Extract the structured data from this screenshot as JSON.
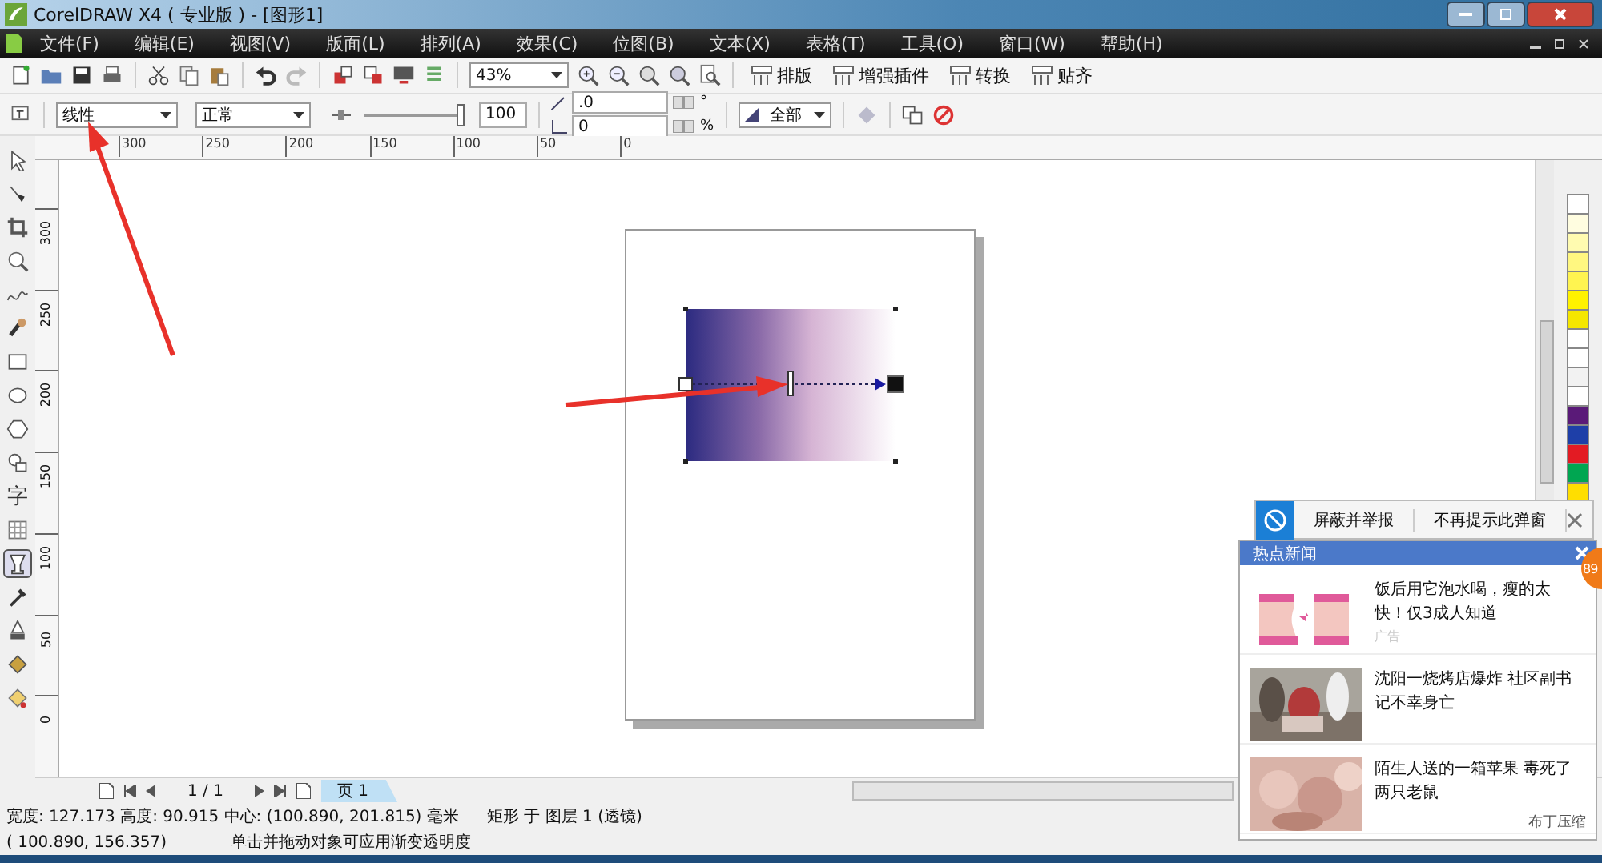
{
  "window": {
    "title": "CorelDRAW X4 ( 专业版 ) - [图形1]"
  },
  "menu": [
    "文件(F)",
    "编辑(E)",
    "视图(V)",
    "版面(L)",
    "排列(A)",
    "效果(C)",
    "位图(B)",
    "文本(X)",
    "表格(T)",
    "工具(O)",
    "窗口(W)",
    "帮助(H)"
  ],
  "toolbar": {
    "zoom": "43%",
    "buttons": [
      "排版",
      "增强插件",
      "转换",
      "贴齐"
    ]
  },
  "property_bar": {
    "fill_type": "线性",
    "mode": "正常",
    "slider": {
      "level": 1.0
    },
    "opacity": "100",
    "angle": ".0",
    "edge": "0",
    "angle_unit": "°",
    "edge_unit": "%",
    "target": "全部"
  },
  "ruler": {
    "horizontal": [
      "300",
      "250",
      "200",
      "150",
      "100",
      "50",
      "0"
    ],
    "vertical": [
      "300",
      "250",
      "200",
      "150",
      "100",
      "50",
      "0"
    ]
  },
  "tools": [
    {
      "kind": "pick",
      "selected": false
    },
    {
      "kind": "shape",
      "selected": false
    },
    {
      "kind": "crop",
      "selected": false
    },
    {
      "kind": "zoom",
      "selected": false
    },
    {
      "kind": "curve",
      "selected": false
    },
    {
      "kind": "smart",
      "selected": false
    },
    {
      "kind": "rect",
      "selected": false
    },
    {
      "kind": "ellipse",
      "selected": false
    },
    {
      "kind": "polygon",
      "selected": false
    },
    {
      "kind": "shapes",
      "selected": false
    },
    {
      "kind": "text",
      "label": "字",
      "selected": false
    },
    {
      "kind": "table",
      "selected": false
    },
    {
      "kind": "transparency",
      "selected": true
    },
    {
      "kind": "eyedropper",
      "selected": false
    },
    {
      "kind": "outline",
      "selected": false
    },
    {
      "kind": "fill",
      "selected": false
    },
    {
      "kind": "smartfill",
      "selected": false
    }
  ],
  "palette": [
    {
      "color": "#ffffff"
    },
    {
      "color": "#fffde0"
    },
    {
      "color": "#fffbb0"
    },
    {
      "color": "#fff780"
    },
    {
      "color": "#fff450"
    },
    {
      "color": "#fff200"
    },
    {
      "color": "#f5e600"
    },
    {
      "color": "#ffffff"
    },
    {
      "color": "#ffffff"
    },
    {
      "color": "#f2f2f2"
    },
    {
      "color": "#ffffff"
    },
    {
      "color": "#5a1a78"
    },
    {
      "color": "#1e3fa8"
    },
    {
      "color": "#e31b23"
    },
    {
      "color": "#00a651"
    },
    {
      "color": "#ffde00"
    }
  ],
  "pages": {
    "counter": "1 / 1",
    "tabs": [
      {
        "label": "页 1",
        "selected": true
      }
    ]
  },
  "status": {
    "size": "宽度: 127.173 高度: 90.915 中心: (100.890, 201.815) 毫米",
    "object": "矩形 于 图层 1 (透镜)",
    "cursor": "( 100.890, 156.357)",
    "hint": "单击并拖动对象可应用渐变透明度"
  },
  "popup": {
    "actions": [
      "屏蔽并举报",
      "不再提示此弹窗"
    ],
    "title": "热点新闻",
    "badge": "89",
    "news": [
      {
        "headline": "饭后用它泡水喝，瘦的太快！仅3成人知道",
        "tag": "广告"
      },
      {
        "headline": "沈阳一烧烤店爆炸 社区副书记不幸身亡"
      },
      {
        "headline": "陌生人送的一箱苹果 毒死了两只老鼠"
      }
    ],
    "footer": "布丁压缩"
  }
}
